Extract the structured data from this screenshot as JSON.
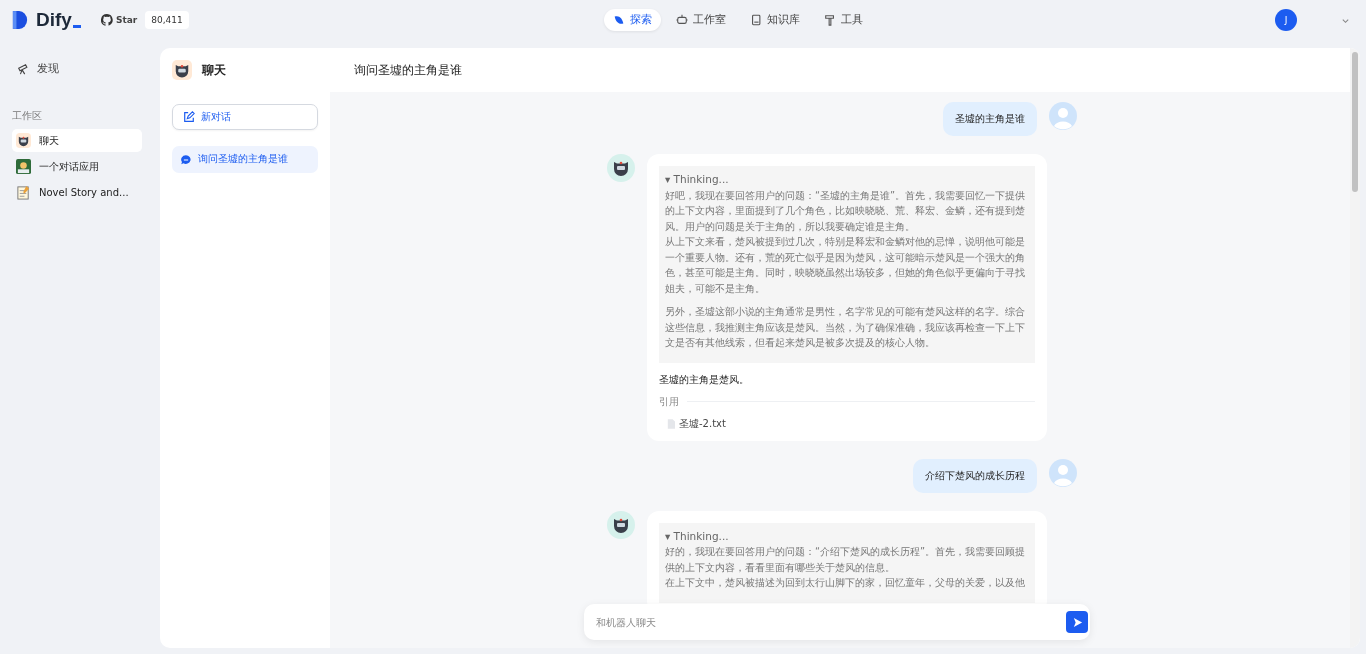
{
  "header": {
    "brand": "Dify",
    "github": {
      "label": "Star",
      "count": "80,411"
    },
    "nav": [
      {
        "label": "探索",
        "kind": "explore",
        "selected": true
      },
      {
        "label": "工作室",
        "kind": "studio",
        "selected": false
      },
      {
        "label": "知识库",
        "kind": "knowledge",
        "selected": false
      },
      {
        "label": "工具",
        "kind": "tools",
        "selected": false
      }
    ],
    "user": {
      "initial": "J"
    }
  },
  "sidebar": {
    "discover": "发现",
    "section": "工作区",
    "apps": [
      {
        "name": "聊天",
        "kind": "bot",
        "selected": true
      },
      {
        "name": "一个对话应用",
        "kind": "scene",
        "selected": false
      },
      {
        "name": "Novel Story and...",
        "kind": "note",
        "selected": false
      }
    ]
  },
  "app_panel": {
    "title": "聊天",
    "new_chat": "新对话",
    "conversations": [
      {
        "title": "询问圣墟的主角是谁",
        "selected": true
      }
    ]
  },
  "chat": {
    "title": "询问圣墟的主角是谁",
    "messages": [
      {
        "kind": "user",
        "text": "圣墟的主角是谁"
      },
      {
        "kind": "bot",
        "thinking_label": "▾ Thinking...",
        "thinking": [
          [
            "好吧，我现在要回答用户的问题：“圣墟的主角是谁”。首先，我需要回忆一下提供的上下文内容，里面提到了几个角色，比如映晓晓、荒、释宏、金鳞，还有提到楚风。用户的问题是关于主角的，所以我要确定谁是主角。",
            "从上下文来看，楚风被提到过几次，特别是释宏和金鳞对他的忌惮，说明他可能是一个重要人物。还有，荒的死亡似乎是因为楚风，这可能暗示楚风是一个强大的角色，甚至可能是主角。同时，映晓晓虽然出场较多，但她的角色似乎更偏向于寻找姐夫，可能不是主角。"
          ],
          [
            "另外，圣墟这部小说的主角通常是男性，名字常见的可能有楚风这样的名字。综合这些信息，我推测主角应该是楚风。当然，为了确保准确，我应该再检查一下上下文是否有其他线索，但看起来楚风是被多次提及的核心人物。"
          ]
        ],
        "answer": "圣墟的主角是楚风。",
        "citation_label": "引用",
        "citations": [
          "圣墟-2.txt"
        ]
      },
      {
        "kind": "user",
        "text": "介绍下楚风的成长历程"
      },
      {
        "kind": "bot",
        "thinking_label": "▾ Thinking...",
        "thinking": [
          [
            "好的，我现在要回答用户的问题：“介绍下楚风的成长历程”。首先，我需要回顾提供的上下文内容，看看里面有哪些关于楚风的信息。",
            "在上下文中，楚风被描述为回到太行山脚下的家，回忆童年，父母的关爱，以及他"
          ]
        ]
      }
    ],
    "input": {
      "placeholder": "和机器人聊天"
    }
  }
}
